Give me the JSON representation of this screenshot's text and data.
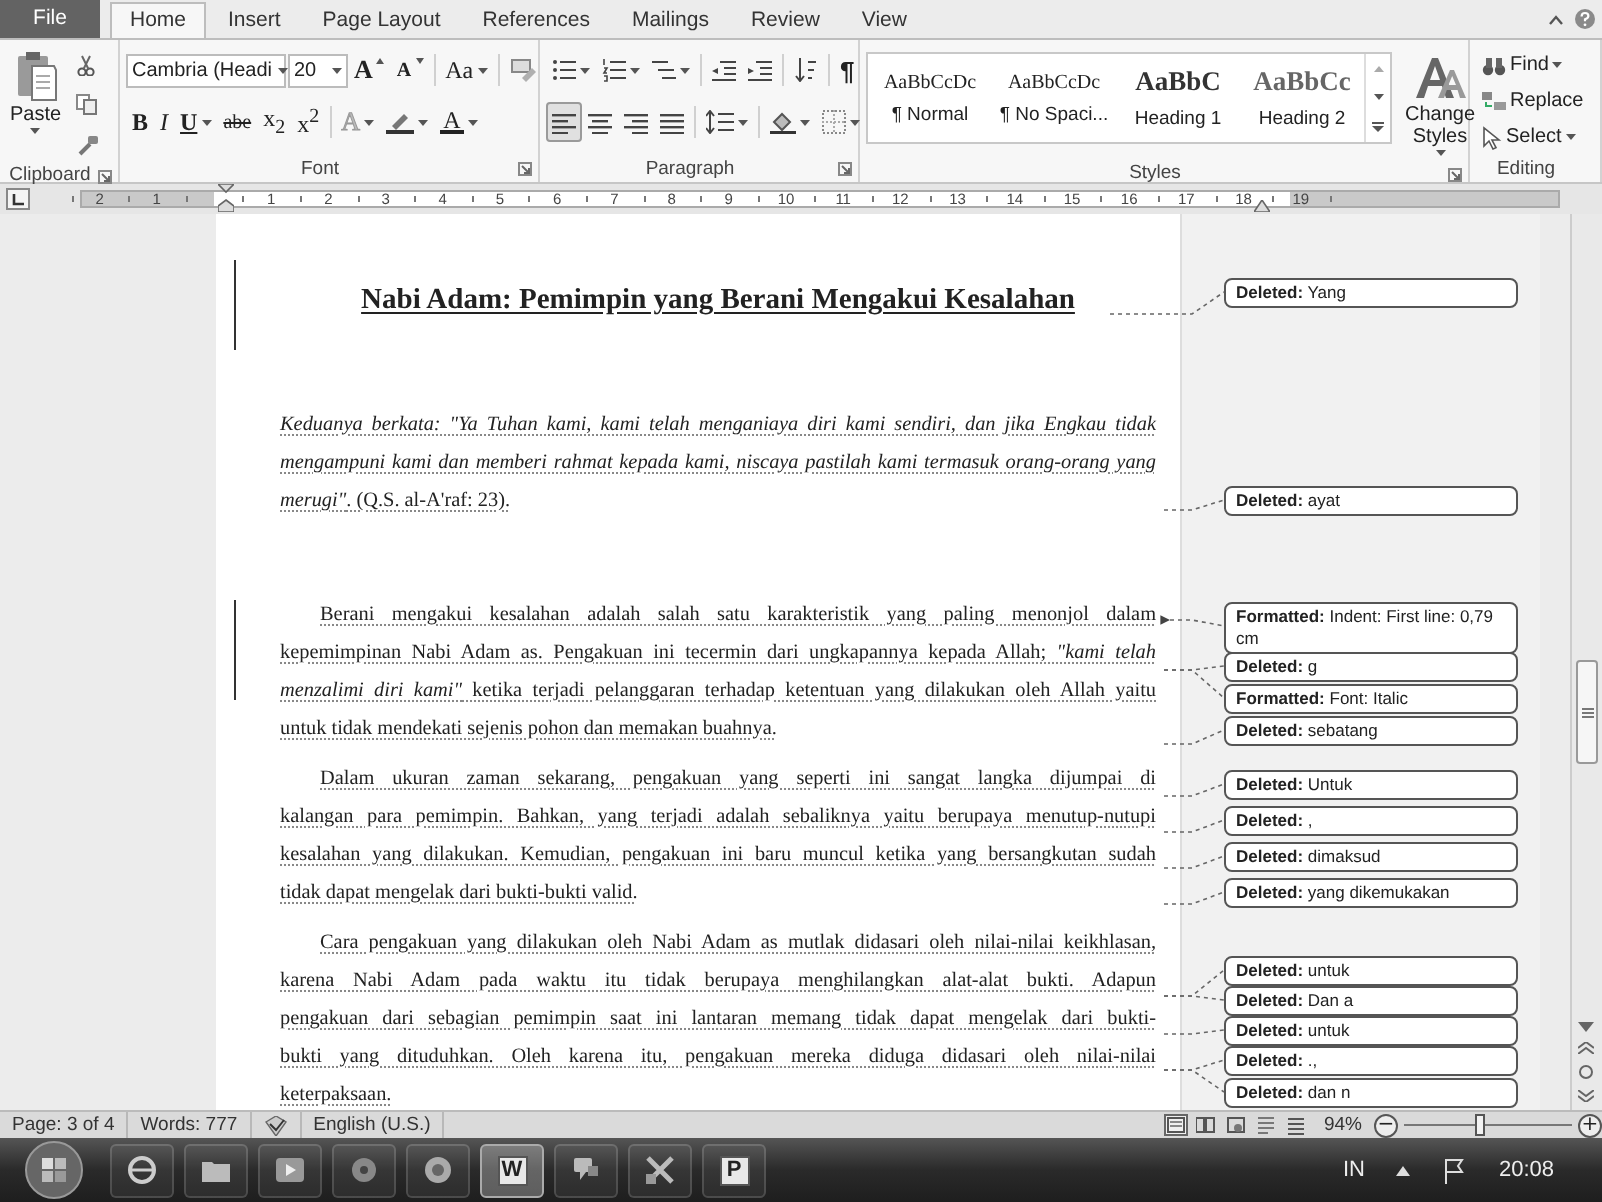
{
  "tabs": [
    {
      "label": "File",
      "kind": "file",
      "selected": false
    },
    {
      "label": "Home",
      "kind": "tab",
      "selected": true
    },
    {
      "label": "Insert",
      "kind": "tab",
      "selected": false
    },
    {
      "label": "Page Layout",
      "kind": "tab",
      "selected": false
    },
    {
      "label": "References",
      "kind": "tab",
      "selected": false
    },
    {
      "label": "Mailings",
      "kind": "tab",
      "selected": false
    },
    {
      "label": "Review",
      "kind": "tab",
      "selected": false
    },
    {
      "label": "View",
      "kind": "tab",
      "selected": false
    }
  ],
  "ribbon": {
    "clipboard": {
      "paste": "Paste",
      "label": "Clipboard"
    },
    "font": {
      "name": "Cambria (Headi",
      "size": "20",
      "grow": "A",
      "shrink": "A",
      "case": "Aa",
      "bold": "B",
      "italic": "I",
      "underline": "U",
      "strike": "abe",
      "subscript": "x$_{2}$",
      "superscript": "x$^{2}$",
      "effects": "A",
      "font_color": "A",
      "label": "Font"
    },
    "paragraph": {
      "show_marks": "¶",
      "alignment": [
        {
          "selected": true
        },
        {
          "selected": false
        },
        {
          "selected": false
        },
        {
          "selected": false
        }
      ],
      "label": "Paragraph"
    },
    "styles": {
      "items": [
        {
          "preview": "AaBbCcDc",
          "name": "¶ Normal",
          "kind": "normal"
        },
        {
          "preview": "AaBbCcDc",
          "name": "¶ No Spaci...",
          "kind": "normal"
        },
        {
          "preview": "AaBbC",
          "name": "Heading 1",
          "kind": "heading1"
        },
        {
          "preview": "AaBbCc",
          "name": "Heading 2",
          "kind": "heading2"
        }
      ],
      "change": "Change Styles",
      "label": "Styles"
    },
    "editing": {
      "find": "Find",
      "replace": "Replace",
      "select": "Select",
      "label": "Editing"
    }
  },
  "ruler": {
    "before": [
      "2",
      "1"
    ],
    "after": [
      "1",
      "2",
      "3",
      "4",
      "5",
      "6",
      "7",
      "8",
      "9",
      "10",
      "11",
      "12",
      "13",
      "14",
      "15",
      "16",
      "17",
      "18",
      "19"
    ]
  },
  "document": {
    "title": "Nabi Adam: Pemimpin yang Berani Mengakui Kesalahan",
    "paragraphs": [
      {
        "indented": false,
        "lines": [
          "*Keduanya berkata: \"Ya Tuhan kami, kami telah menganiaya diri kami sendiri, dan jika Engkau tidak*",
          "*mengampuni kami dan memberi rahmat kepada kami, niscaya pastilah kami termasuk orang-orang yang*",
          "*merugi\"*. (Q.S. al-A'raf: 23)."
        ]
      },
      {
        "indented": true,
        "lines": [
          "Berani mengakui kesalahan adalah salah satu karakteristik yang paling menonjol dalam",
          "kepemimpinan Nabi Adam as. Pengakuan ini tecermin dari ungkapannya kepada Allah; *\"kami telah*",
          "*menzalimi diri kami\"* ketika terjadi pelanggaran terhadap ketentuan yang dilakukan oleh Allah yaitu",
          "untuk tidak mendekati sejenis pohon dan memakan buahnya."
        ]
      },
      {
        "indented": true,
        "lines": [
          "Dalam ukuran zaman sekarang, pengakuan yang seperti ini sangat langka dijumpai di",
          "kalangan para pemimpin. Bahkan, yang terjadi adalah sebaliknya yaitu berupaya menutup-nutupi",
          "kesalahan yang dilakukan. Kemudian, pengakuan ini baru muncul ketika yang bersangkutan sudah",
          "tidak dapat mengelak dari bukti-bukti valid."
        ]
      },
      {
        "indented": true,
        "lines": [
          "Cara pengakuan yang dilakukan oleh Nabi Adam as mutlak didasari oleh nilai-nilai keikhlasan,",
          "karena Nabi Adam pada waktu itu tidak berupaya menghilangkan alat-alat bukti. Adapun",
          "pengakuan dari sebagian pemimpin saat ini lantaran memang tidak dapat mengelak dari bukti-",
          "bukti yang dituduhkan. Oleh karena itu, pengakuan mereka diduga didasari oleh nilai-nilai",
          "keterpaksaan."
        ]
      }
    ],
    "balloons": [
      {
        "text": "**Deleted:** Yang"
      },
      {
        "text": "**Deleted:** ayat"
      },
      {
        "text": "**Formatted:** Indent: First line: 0,79 cm"
      },
      {
        "text": "**Deleted:** g"
      },
      {
        "text": "**Formatted:** Font: Italic"
      },
      {
        "text": "**Deleted:** sebatang"
      },
      {
        "text": "**Deleted:** Untuk"
      },
      {
        "text": "**Deleted:** ,"
      },
      {
        "text": "**Deleted:** dimaksud"
      },
      {
        "text": "**Deleted:** yang dikemukakan"
      },
      {
        "text": "**Deleted:** untuk"
      },
      {
        "text": "**Deleted:** Dan a"
      },
      {
        "text": "**Deleted:** untuk"
      },
      {
        "text": "**Deleted:** .,"
      },
      {
        "text": "**Deleted:** dan n"
      }
    ]
  },
  "status_bar": {
    "page": "Page: 3 of 4",
    "words": "Words: 777",
    "language": "English (U.S.)",
    "views": [
      {
        "selected": true
      },
      {
        "selected": false
      },
      {
        "selected": false
      },
      {
        "selected": false
      },
      {
        "selected": false
      }
    ],
    "zoom": "94%",
    "zoom_out": "−",
    "zoom_in": "+",
    "level": 0.45
  },
  "taskbar": {
    "apps": [
      {
        "kind": "browser",
        "selected": false
      },
      {
        "kind": "folder",
        "selected": false
      },
      {
        "kind": "media",
        "selected": false
      },
      {
        "kind": "disc",
        "selected": false
      },
      {
        "kind": "globe",
        "selected": false
      },
      {
        "kind": "letter",
        "label": "W",
        "selected": true
      },
      {
        "kind": "chat",
        "selected": false
      },
      {
        "kind": "tool",
        "selected": false
      },
      {
        "kind": "letter",
        "label": "P",
        "selected": false
      }
    ],
    "language": "IN",
    "time": "20:08"
  }
}
